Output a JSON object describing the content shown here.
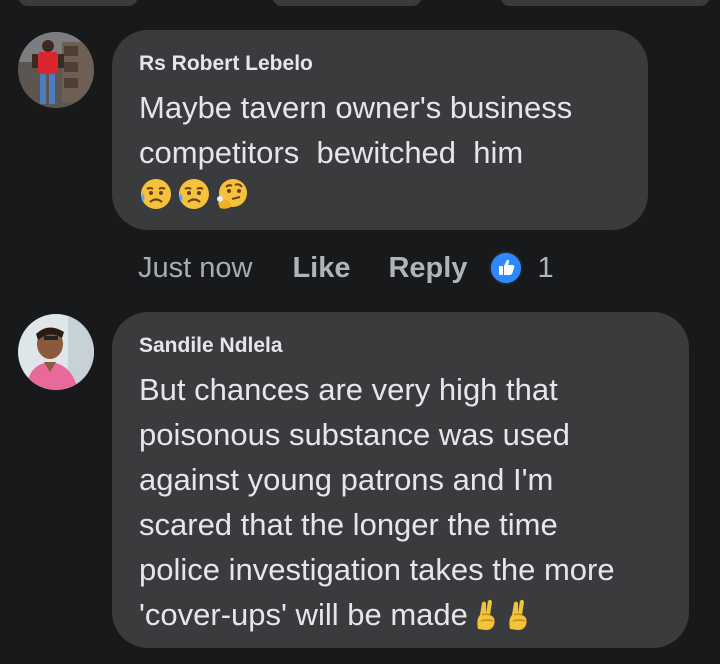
{
  "comments": [
    {
      "author": "Rs Robert Lebelo",
      "text": "Maybe tavern owner's business\ncompetitors  bewitched  him",
      "emojis": [
        "sad-sweat-emoji",
        "sad-sweat-emoji",
        "thinking-emoji"
      ],
      "time": "Just now",
      "like_label": "Like",
      "reply_label": "Reply",
      "reaction_count": "1"
    },
    {
      "author": "Sandile Ndlela",
      "text": "But chances are very high that\npoisonous substance was used\nagainst young patrons and I'm\nscared that the longer the time\npolice investigation takes the more\n'cover-ups' will be made",
      "emojis": [
        "crossed-fingers-emoji",
        "crossed-fingers-emoji"
      ]
    }
  ],
  "colors": {
    "background": "#18191a",
    "bubble": "#3a3b3c",
    "text": "#e4e6eb",
    "secondary_text": "#b0b3b8",
    "like_blue": "#2e89ff"
  }
}
